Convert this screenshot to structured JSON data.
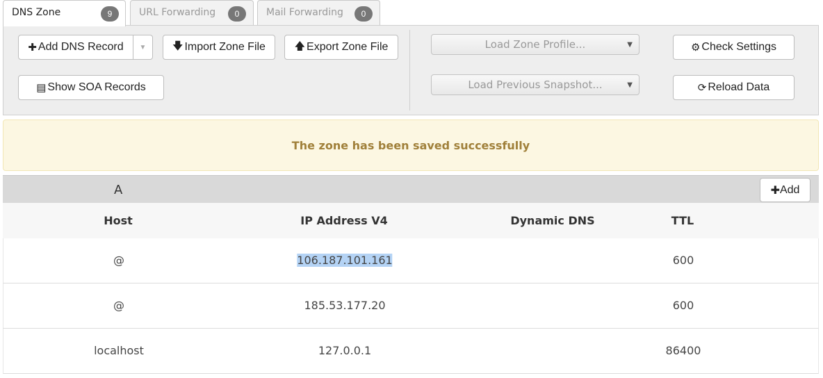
{
  "tabs": [
    {
      "label": "DNS Zone",
      "count": "9"
    },
    {
      "label": "URL Forwarding",
      "count": "0"
    },
    {
      "label": "Mail Forwarding",
      "count": "0"
    }
  ],
  "toolbar": {
    "add_dns_record": "Add DNS Record",
    "import_zone_file": "Import Zone File",
    "export_zone_file": "Export Zone File",
    "show_soa_records": "Show SOA Records",
    "load_zone_profile": "Load Zone Profile...",
    "load_previous_snapshot": "Load Previous Snapshot...",
    "check_settings": "Check Settings",
    "reload_data": "Reload Data"
  },
  "alert": {
    "message": "The zone has been saved successfully"
  },
  "section": {
    "title": "A",
    "add_label": "Add"
  },
  "table": {
    "columns": [
      "Host",
      "IP Address V4",
      "Dynamic DNS",
      "TTL"
    ],
    "rows": [
      {
        "host": "@",
        "ip": "106.187.101.161",
        "dynamic": "",
        "ttl": "600"
      },
      {
        "host": "@",
        "ip": "185.53.177.20",
        "dynamic": "",
        "ttl": "600"
      },
      {
        "host": "localhost",
        "ip": "127.0.0.1",
        "dynamic": "",
        "ttl": "86400"
      }
    ]
  },
  "colors": {
    "alert_bg": "#fcf7e2",
    "alert_text": "#a0803a",
    "badge": "#777777",
    "selection": "#b4d3f5"
  }
}
